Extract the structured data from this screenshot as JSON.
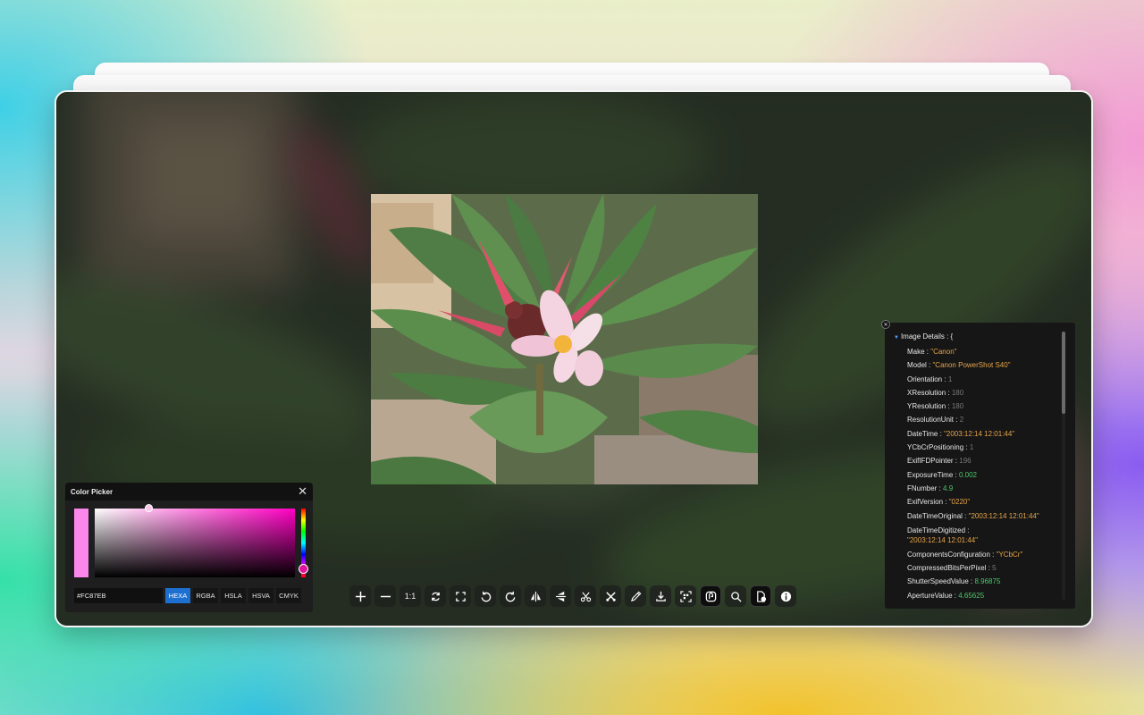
{
  "toolbar": {
    "buttons": [
      {
        "name": "zoom-in",
        "icon": "plus-icon"
      },
      {
        "name": "zoom-out",
        "icon": "minus-icon"
      },
      {
        "name": "actual-size",
        "icon": "ratio-icon",
        "label": "1:1"
      },
      {
        "name": "reset",
        "icon": "reset-icon"
      },
      {
        "name": "fullscreen",
        "icon": "fullscreen-icon"
      },
      {
        "name": "rotate-left",
        "icon": "rotate-left-icon"
      },
      {
        "name": "rotate-right",
        "icon": "rotate-right-icon"
      },
      {
        "name": "flip-horizontal",
        "icon": "flip-horizontal-icon"
      },
      {
        "name": "flip-vertical",
        "icon": "flip-vertical-icon"
      },
      {
        "name": "crop",
        "icon": "scissors-icon"
      },
      {
        "name": "crop-alt",
        "icon": "scissors-cross-icon"
      },
      {
        "name": "eyedropper",
        "icon": "eyedropper-icon"
      },
      {
        "name": "download",
        "icon": "download-icon"
      },
      {
        "name": "scan-qr",
        "icon": "scan-icon"
      },
      {
        "name": "ocr",
        "icon": "text-recognition-icon"
      },
      {
        "name": "search",
        "icon": "search-icon"
      },
      {
        "name": "image-details",
        "icon": "image-info-icon"
      },
      {
        "name": "info",
        "icon": "info-icon"
      }
    ]
  },
  "color_picker": {
    "title": "Color Picker",
    "close_glyph": "✕",
    "swatch_color": "#FC87EB",
    "hue_color": "#ff00c3",
    "hex_value": "#FC87EB",
    "modes": [
      "HEXA",
      "RGBA",
      "HSLA",
      "HSVA",
      "CMYK"
    ],
    "selected_mode": "HEXA"
  },
  "details": {
    "close_glyph": "✕",
    "title": "Image Details",
    "title_suffix": " : {",
    "rows": [
      {
        "key": "Make",
        "value": "\"Canon\"",
        "kind": "str"
      },
      {
        "key": "Model",
        "value": "\"Canon PowerShot S40\"",
        "kind": "str"
      },
      {
        "key": "Orientation",
        "value": "1",
        "kind": "num"
      },
      {
        "key": "XResolution",
        "value": "180",
        "kind": "num"
      },
      {
        "key": "YResolution",
        "value": "180",
        "kind": "num"
      },
      {
        "key": "ResolutionUnit",
        "value": "2",
        "kind": "num"
      },
      {
        "key": "DateTime",
        "value": "\"2003:12:14 12:01:44\"",
        "kind": "str"
      },
      {
        "key": "YCbCrPositioning",
        "value": "1",
        "kind": "num"
      },
      {
        "key": "ExifIFDPointer",
        "value": "196",
        "kind": "num"
      },
      {
        "key": "ExposureTime",
        "value": "0.002",
        "kind": "float"
      },
      {
        "key": "FNumber",
        "value": "4.9",
        "kind": "float"
      },
      {
        "key": "ExifVersion",
        "value": "\"0220\"",
        "kind": "str"
      },
      {
        "key": "DateTimeOriginal",
        "value": "\"2003:12:14 12:01:44\"",
        "kind": "str"
      },
      {
        "key": "DateTimeDigitized",
        "value": "\"2003:12:14 12:01:44\"",
        "kind": "str",
        "wrap": true
      },
      {
        "key": "ComponentsConfiguration",
        "value": "\"YCbCr\"",
        "kind": "str"
      },
      {
        "key": "CompressedBitsPerPixel",
        "value": "5",
        "kind": "num"
      },
      {
        "key": "ShutterSpeedValue",
        "value": "8.96875",
        "kind": "float"
      },
      {
        "key": "ApertureValue",
        "value": "4.65625",
        "kind": "float"
      }
    ]
  },
  "colors": {
    "string_value": "#e6a44a",
    "number_value": "#787878",
    "float_value": "#4cc86a",
    "mode_selected": "#1d6fd0"
  }
}
